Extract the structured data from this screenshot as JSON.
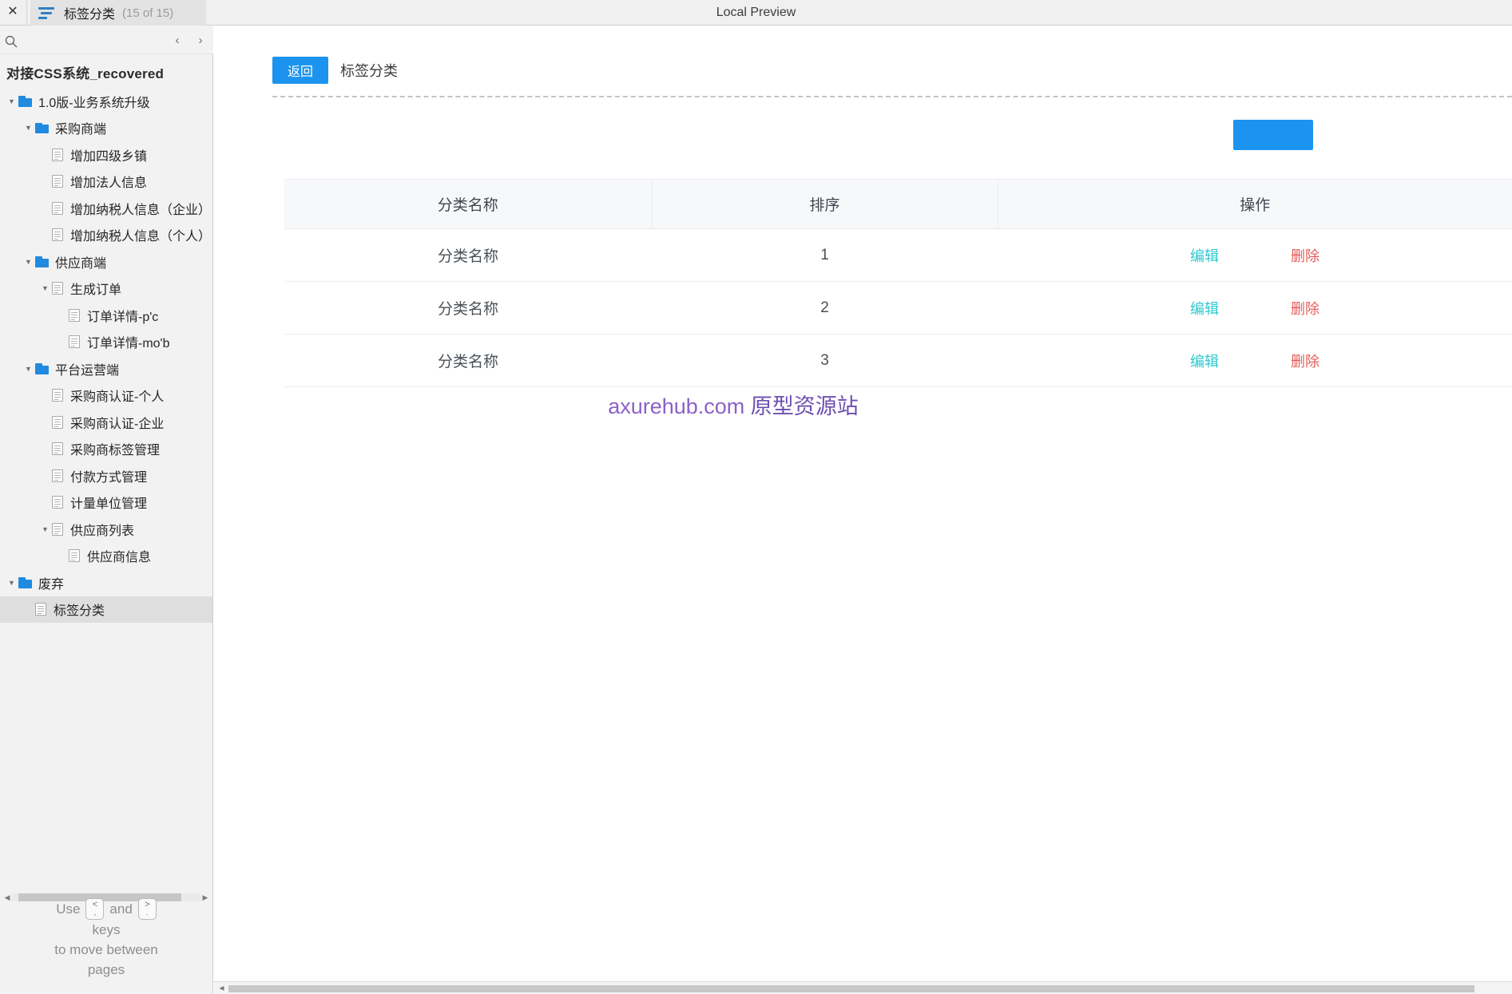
{
  "window": {
    "preview_title": "Local Preview",
    "close_icon": "close-icon"
  },
  "tab": {
    "label": "标签分类",
    "count": "(15 of 15)",
    "icon": "sitemap-icon"
  },
  "sidebar": {
    "search_icon": "search-icon",
    "prev_icon": "‹",
    "next_icon": "›",
    "project_name": "对接CSS系统_recovered",
    "tree": [
      {
        "label": "1.0版-业务系统升级",
        "depth": 0,
        "type": "folder",
        "twisty": "open",
        "selected": false
      },
      {
        "label": "采购商端",
        "depth": 1,
        "type": "folder",
        "twisty": "open",
        "selected": false
      },
      {
        "label": "增加四级乡镇",
        "depth": 2,
        "type": "page",
        "twisty": "none",
        "selected": false
      },
      {
        "label": "增加法人信息",
        "depth": 2,
        "type": "page",
        "twisty": "none",
        "selected": false
      },
      {
        "label": "增加纳税人信息（企业）",
        "depth": 2,
        "type": "page",
        "twisty": "none",
        "selected": false
      },
      {
        "label": "增加纳税人信息（个人）",
        "depth": 2,
        "type": "page",
        "twisty": "none",
        "selected": false
      },
      {
        "label": "供应商端",
        "depth": 1,
        "type": "folder",
        "twisty": "open",
        "selected": false
      },
      {
        "label": "生成订单",
        "depth": 2,
        "type": "page",
        "twisty": "open",
        "selected": false
      },
      {
        "label": "订单详情-p'c",
        "depth": 3,
        "type": "page",
        "twisty": "none",
        "selected": false
      },
      {
        "label": "订单详情-mo'b",
        "depth": 3,
        "type": "page",
        "twisty": "none",
        "selected": false
      },
      {
        "label": "平台运营端",
        "depth": 1,
        "type": "folder",
        "twisty": "open",
        "selected": false
      },
      {
        "label": "采购商认证-个人",
        "depth": 2,
        "type": "page",
        "twisty": "none",
        "selected": false
      },
      {
        "label": "采购商认证-企业",
        "depth": 2,
        "type": "page",
        "twisty": "none",
        "selected": false
      },
      {
        "label": "采购商标签管理",
        "depth": 2,
        "type": "page",
        "twisty": "none",
        "selected": false
      },
      {
        "label": "付款方式管理",
        "depth": 2,
        "type": "page",
        "twisty": "none",
        "selected": false
      },
      {
        "label": "计量单位管理",
        "depth": 2,
        "type": "page",
        "twisty": "none",
        "selected": false
      },
      {
        "label": "供应商列表",
        "depth": 2,
        "type": "page",
        "twisty": "open",
        "selected": false
      },
      {
        "label": "供应商信息",
        "depth": 3,
        "type": "page",
        "twisty": "none",
        "selected": false
      },
      {
        "label": "废弃",
        "depth": 0,
        "type": "folder",
        "twisty": "open",
        "selected": false
      },
      {
        "label": "标签分类",
        "depth": 1,
        "type": "page",
        "twisty": "none",
        "selected": true
      }
    ],
    "hint": {
      "use": "Use",
      "and": "and",
      "key_prev_top": "<",
      "key_prev_bottom": ",",
      "key_next_top": ">",
      "key_next_bottom": ".",
      "line2": "keys",
      "line3": "to move between",
      "line4": "pages"
    }
  },
  "main": {
    "back_button": "返回",
    "breadcrumb_title": "标签分类",
    "accent_color": "#1c94ef",
    "table": {
      "headers": [
        "分类名称",
        "排序",
        "操作"
      ],
      "rows": [
        {
          "name": "分类名称",
          "sort": "1",
          "edit": "编辑",
          "delete": "删除"
        },
        {
          "name": "分类名称",
          "sort": "2",
          "edit": "编辑",
          "delete": "删除"
        },
        {
          "name": "分类名称",
          "sort": "3",
          "edit": "编辑",
          "delete": "删除"
        }
      ],
      "edit_color": "#2ec7cf",
      "delete_color": "#e45b5b"
    },
    "watermark": {
      "domain": "axurehub.com ",
      "cn": "原型资源站",
      "color": "#8b62c9"
    }
  }
}
